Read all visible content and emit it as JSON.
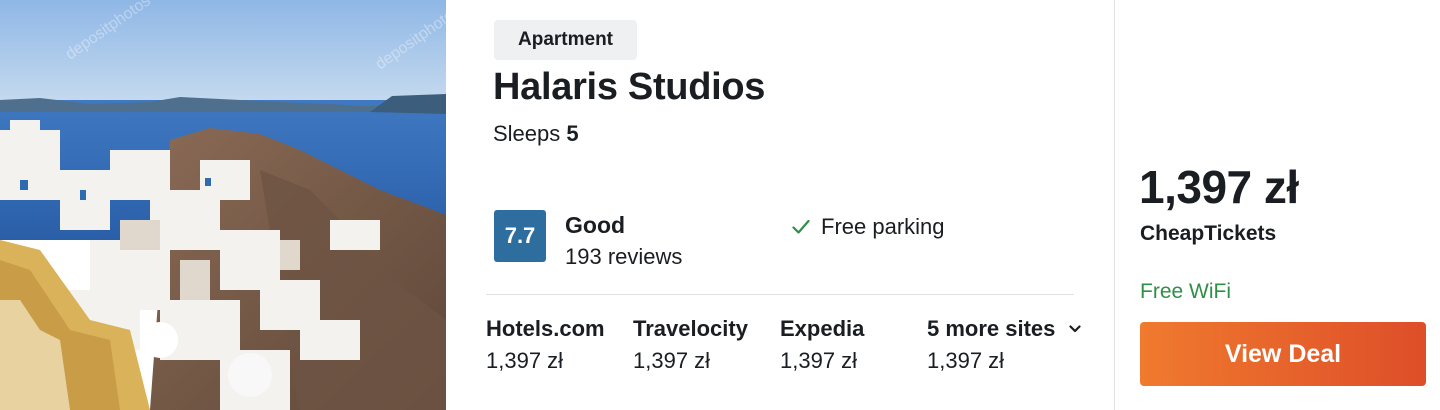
{
  "listing": {
    "type_badge": "Apartment",
    "name": "Halaris Studios",
    "sleeps_label": "Sleeps",
    "sleeps_value": "5",
    "rating": {
      "score": "7.7",
      "label": "Good",
      "reviews": "193 reviews",
      "color": "#2e6e9e"
    },
    "amenity": {
      "icon": "check-icon",
      "label": "Free parking",
      "icon_color": "#2f8f46"
    },
    "sites": [
      {
        "name": "Hotels.com",
        "price": "1,397 zł"
      },
      {
        "name": "Travelocity",
        "price": "1,397 zł"
      },
      {
        "name": "Expedia",
        "price": "1,397 zł"
      },
      {
        "name": "5 more sites",
        "price": "1,397 zł",
        "icon": "chevron-down-icon"
      }
    ]
  },
  "deal": {
    "price": "1,397 zł",
    "provider": "CheapTickets",
    "perk": "Free WiFi",
    "button_label": "View Deal",
    "button_color_start": "#f07a2e",
    "button_color_end": "#de4e29",
    "perk_color": "#2f8f46"
  },
  "photo": {
    "icon": "hotel-photo"
  }
}
